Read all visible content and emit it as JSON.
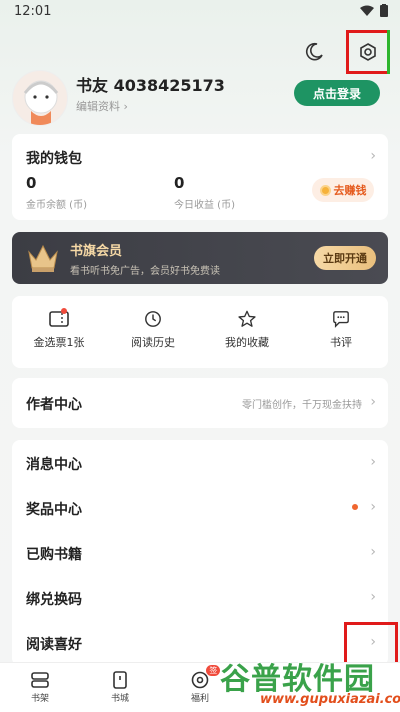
{
  "status_bar": {
    "time": "12:01"
  },
  "profile": {
    "nickname": "书友 4038425173",
    "edit_label": "编辑资料",
    "login_button": "点击登录"
  },
  "wallet": {
    "title": "我的钱包",
    "coins_value": "0",
    "coins_label": "金币余额 (币)",
    "income_value": "0",
    "income_label": "今日收益 (币)",
    "earn_button": "去赚钱"
  },
  "vip": {
    "title": "书旗会员",
    "subtitle": "看书听书免广告，会员好书免费读",
    "button": "立即开通"
  },
  "shortcuts": [
    {
      "label": "金选票1张",
      "icon": "ticket-icon"
    },
    {
      "label": "阅读历史",
      "icon": "clock-icon"
    },
    {
      "label": "我的收藏",
      "icon": "star-icon"
    },
    {
      "label": "书评",
      "icon": "comment-icon"
    }
  ],
  "author": {
    "title": "作者中心",
    "subtitle": "零门槛创作，千万现金扶持"
  },
  "menu": [
    {
      "label": "消息中心"
    },
    {
      "label": "奖品中心"
    },
    {
      "label": "已购书籍"
    },
    {
      "label": "绑兑换码"
    },
    {
      "label": "阅读喜好"
    }
  ],
  "bottom_nav": [
    {
      "label": "书架",
      "icon": "bookshelf-icon"
    },
    {
      "label": "书城",
      "icon": "bookstore-icon"
    },
    {
      "label": "福利",
      "icon": "welfare-icon",
      "badge": "签"
    }
  ],
  "watermark": {
    "text": "谷普软件园",
    "url": "www.gupuxiazai.com"
  },
  "colors": {
    "accent": "#1e9463",
    "highlight_box": "#e01a1a",
    "vip_bg": "#3c3d44"
  }
}
